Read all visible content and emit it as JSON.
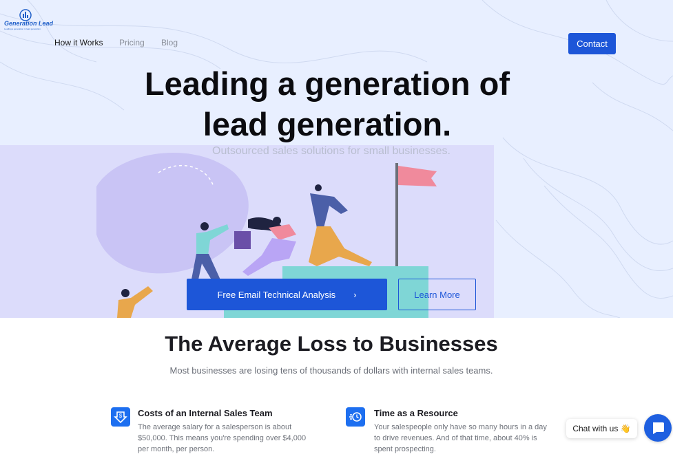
{
  "brand": {
    "name": "Generation Lead",
    "tagline": "Leading a generation in lead generation."
  },
  "nav": {
    "items": [
      {
        "label": "How it Works"
      },
      {
        "label": "Pricing"
      },
      {
        "label": "Blog"
      }
    ],
    "contact_label": "Contact"
  },
  "hero": {
    "title_line1": "Leading a generation of",
    "title_line2": "lead generation.",
    "subtitle": "Outsourced sales solutions for small businesses.",
    "primary_cta": "Free Email Technical Analysis",
    "secondary_cta": "Learn More"
  },
  "section": {
    "title": "The Average Loss to Businesses",
    "subtitle": "Most businesses are losing tens of thousands of dollars with internal sales teams."
  },
  "features": [
    {
      "icon": "dollar-download-icon",
      "title": "Costs of an Internal Sales Team",
      "line1": "The average salary for a salesperson is about",
      "line2": "$50,000.  This means you're spending over $4,000",
      "line3": "per month, per person."
    },
    {
      "icon": "time-clock-icon",
      "title": "Time as a Resource",
      "line1": "Your salespeople only have so many hours in a day",
      "line2": "to drive revenues.  And of that time, about 40% is",
      "line3": "spent prospecting."
    }
  ],
  "chat": {
    "label": "Chat with us",
    "emoji": "👋"
  },
  "colors": {
    "accent": "#1d56d8",
    "hero_bg": "#e8efff",
    "illustration_bg": "#dcdcfb"
  }
}
